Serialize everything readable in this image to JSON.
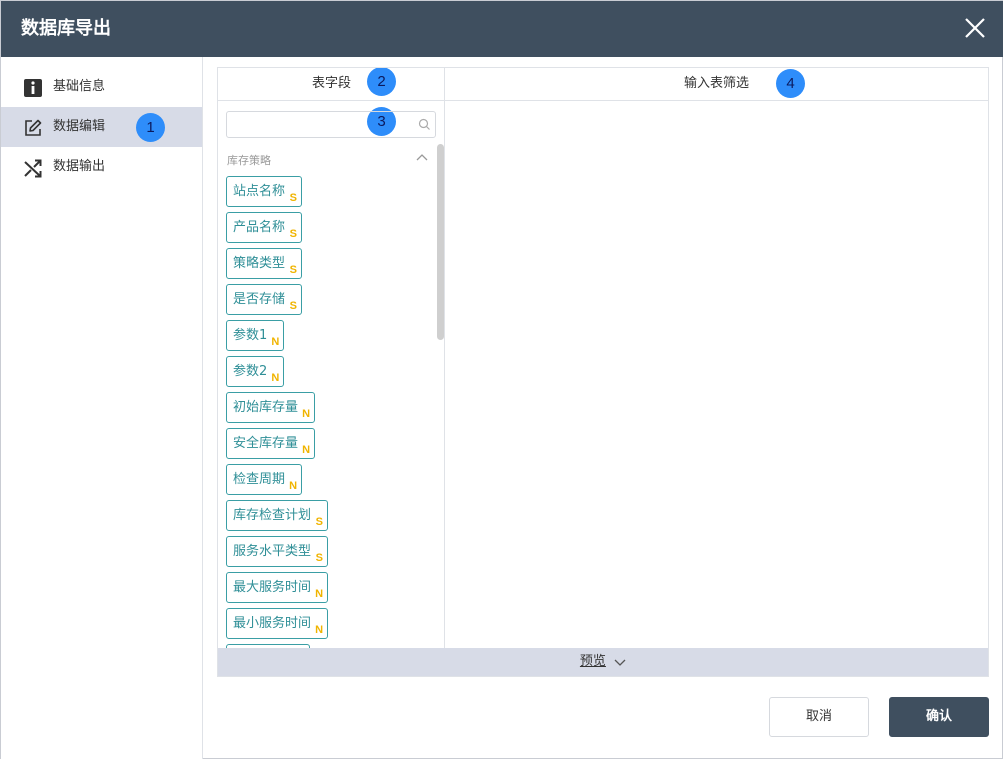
{
  "dialog": {
    "title": "数据库导出",
    "close_icon": "close-icon"
  },
  "sidebar": {
    "items": [
      {
        "label": "基础信息",
        "icon": "info-icon",
        "active": false
      },
      {
        "label": "数据编辑",
        "icon": "edit-icon",
        "active": true
      },
      {
        "label": "数据输出",
        "icon": "shuffle-icon",
        "active": false
      }
    ]
  },
  "annotations": [
    "1",
    "2",
    "3",
    "4"
  ],
  "fields_panel": {
    "header": "表字段",
    "search_placeholder": "",
    "group_label": "库存策略",
    "fields": [
      {
        "name": "站点名称",
        "type": "S"
      },
      {
        "name": "产品名称",
        "type": "S"
      },
      {
        "name": "策略类型",
        "type": "S"
      },
      {
        "name": "是否存储",
        "type": "S"
      },
      {
        "name": "参数1",
        "type": "N"
      },
      {
        "name": "参数2",
        "type": "N"
      },
      {
        "name": "初始库存量",
        "type": "N"
      },
      {
        "name": "安全库存量",
        "type": "N"
      },
      {
        "name": "检查周期",
        "type": "N"
      },
      {
        "name": "库存检查计划",
        "type": "S"
      },
      {
        "name": "服务水平类型",
        "type": "S"
      },
      {
        "name": "最大服务时间",
        "type": "N"
      },
      {
        "name": "最小服务时间",
        "type": "N"
      }
    ]
  },
  "filter_panel": {
    "header": "输入表筛选"
  },
  "preview": {
    "label": "预览"
  },
  "footer": {
    "cancel_label": "取消",
    "confirm_label": "确认"
  },
  "colors": {
    "titlebar": "#3f4f5f",
    "active_nav": "#d7dbe7",
    "tag_border": "#3a9ea5",
    "type_marker": "#f0b400",
    "annotation_badge": "#2e8dfa"
  }
}
